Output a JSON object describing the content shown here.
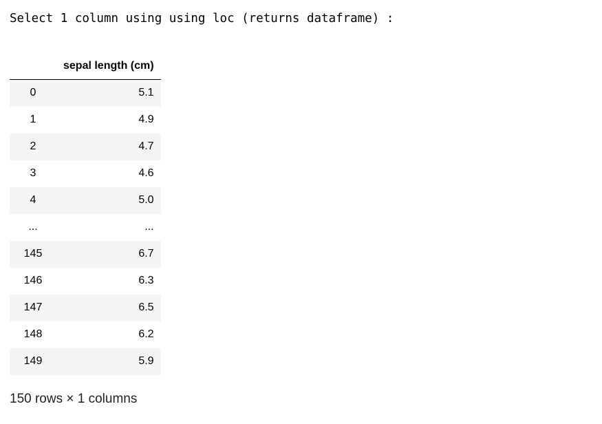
{
  "output_line": "Select 1 column using using loc (returns dataframe) :",
  "table": {
    "index_header": "",
    "column_header": "sepal length (cm)",
    "rows": [
      {
        "index": "0",
        "value": "5.1"
      },
      {
        "index": "1",
        "value": "4.9"
      },
      {
        "index": "2",
        "value": "4.7"
      },
      {
        "index": "3",
        "value": "4.6"
      },
      {
        "index": "4",
        "value": "5.0"
      },
      {
        "index": "...",
        "value": "..."
      },
      {
        "index": "145",
        "value": "6.7"
      },
      {
        "index": "146",
        "value": "6.3"
      },
      {
        "index": "147",
        "value": "6.5"
      },
      {
        "index": "148",
        "value": "6.2"
      },
      {
        "index": "149",
        "value": "5.9"
      }
    ],
    "row_background_odd": "#f5f5f5",
    "row_background_even": "#ffffff"
  },
  "footer": "150 rows × 1 columns"
}
